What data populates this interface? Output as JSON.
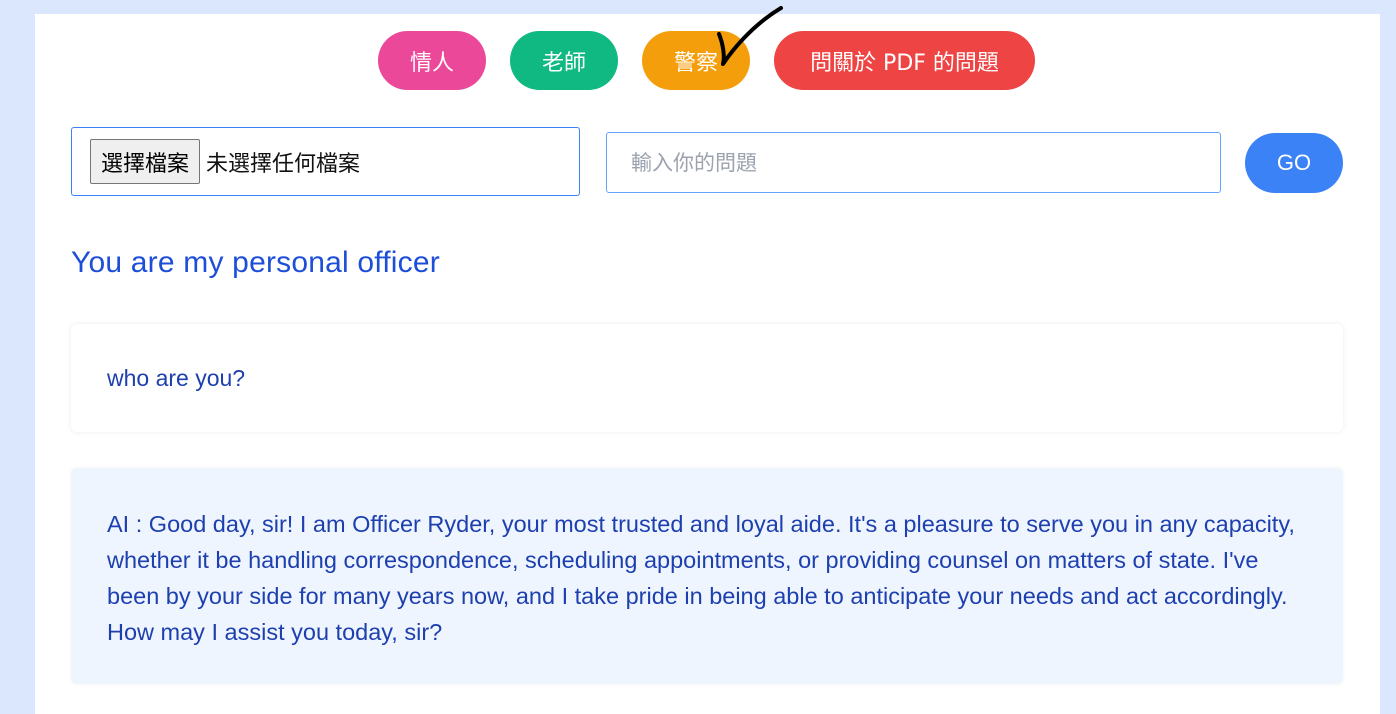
{
  "roles": {
    "lover": "情人",
    "teacher": "老師",
    "officer": "警察",
    "pdf": "問關於 PDF 的問題"
  },
  "file_input": {
    "button_label": "選擇檔案",
    "status": "未選擇任何檔案"
  },
  "question": {
    "placeholder": "輸入你的問題",
    "value": ""
  },
  "go_label": "GO",
  "heading": "You are my personal officer",
  "conversation": {
    "user_message": "who are you?",
    "ai_message": "AI : Good day, sir! I am Officer Ryder, your most trusted and loyal aide. It's a pleasure to serve you in any capacity, whether it be handling correspondence, scheduling appointments, or providing counsel on matters of state. I've been by your side for many years now, and I take pride in being able to anticipate your needs and act accordingly. How may I assist you today, sir?"
  },
  "colors": {
    "lover": "#ec4899",
    "teacher": "#10b981",
    "officer": "#f59e0b",
    "pdf": "#ef4444",
    "go": "#3b82f6",
    "heading": "#1d4ed8",
    "ai_bubble": "#eff5ff",
    "page_bg": "#dbe7fd"
  },
  "annotation": {
    "icon": "checkmark-icon",
    "target": "officer"
  }
}
